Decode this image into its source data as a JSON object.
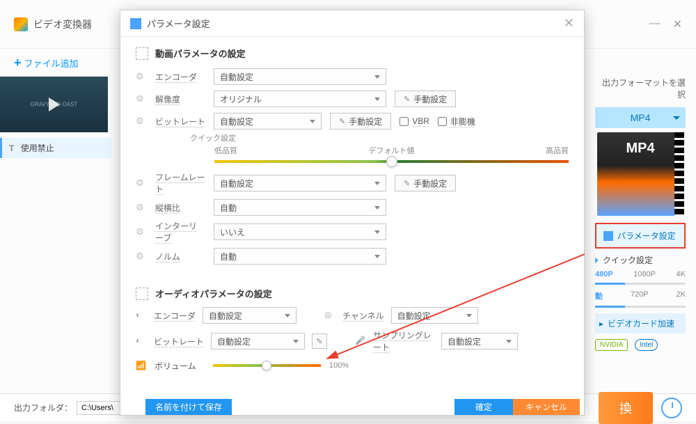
{
  "bg": {
    "app_title": "ビデオ変換器",
    "add_file": "ファイル追加",
    "thumb_label": "GRAVYARD OAST",
    "ban_label": "使用禁止",
    "out_fmt_label": "出力フォーマットを選択",
    "mp4": "MP4",
    "param_btn": "パラメータ設定",
    "quick_set": "クイック設定",
    "res": {
      "r1": "480P",
      "r2": "1080P",
      "r3": "4K",
      "r4": "動",
      "r5": "720P",
      "r6": "2K"
    },
    "gpu_row": "ビデオカード加速",
    "nvidia": "NVIDIA",
    "intel": "Intel",
    "out_folder_label": "出力フォルダ：",
    "out_folder_val": "C:\\Users\\",
    "convert": "換"
  },
  "modal": {
    "title": "パラメータ設定",
    "video_section": "動画パラメータの設定",
    "audio_section": "オーディオパラメータの設定",
    "labels": {
      "encoder": "エンコーダ",
      "resolution": "解像度",
      "bitrate": "ビットレート",
      "framerate": "フレームレート",
      "aspect": "縦横比",
      "interleave": "インターリーブ",
      "norm": "ノルム",
      "channel": "チャンネル",
      "sampling": "サンプリングレート",
      "volume": "ボリューム",
      "quick_quality": "クイック設定"
    },
    "values": {
      "auto": "自動設定",
      "original": "オリジナル",
      "auto2": "自動",
      "no": "いいえ"
    },
    "quality": {
      "low": "低品質",
      "default": "デフォルト値",
      "high": "高品質"
    },
    "manual_btn": "手動設定",
    "vbr": "VBR",
    "deinterlace": "非膨機",
    "volume_val": "100%",
    "save_as": "名前を付けて保存",
    "ok": "確定",
    "cancel": "キャンセル"
  }
}
